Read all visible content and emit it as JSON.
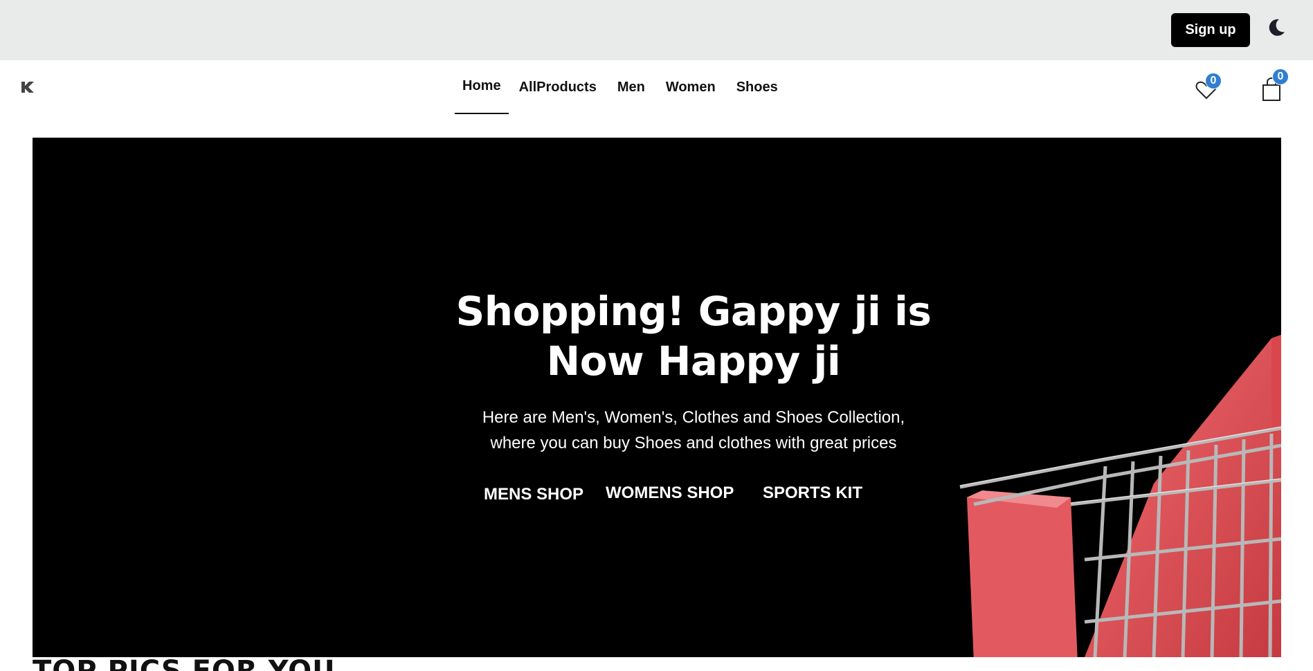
{
  "topbar": {
    "signup_label": "Sign up",
    "theme_icon": "moon-icon"
  },
  "navbar": {
    "logo_icon": "brand-k-logo",
    "links": [
      {
        "label": "Home",
        "active": true
      },
      {
        "label": "AllProducts",
        "active": false
      },
      {
        "label": "Men",
        "active": false
      },
      {
        "label": "Women",
        "active": false
      },
      {
        "label": "Shoes",
        "active": false
      }
    ],
    "wishlist": {
      "icon": "heart-icon",
      "count": "0"
    },
    "cart": {
      "icon": "shopping-bag-icon",
      "count": "0"
    },
    "badge_color": "#2f7fd1"
  },
  "hero": {
    "title_line1": "Shopping! Gappy ji is",
    "title_line2": "Now Happy ji",
    "subtitle_line1": "Here are Men's, Women's, Clothes and Shoes Collection,",
    "subtitle_line2": "where you can buy Shoes and clothes with great prices",
    "ctas": {
      "mens": "MENS SHOP",
      "womens": "WOMENS SHOP",
      "sports": "SPORTS KIT"
    },
    "background_color": "#000000",
    "accent_color": "#e9464d"
  },
  "next_section": {
    "heading_partial": "TOP PICS FOR YOU"
  }
}
